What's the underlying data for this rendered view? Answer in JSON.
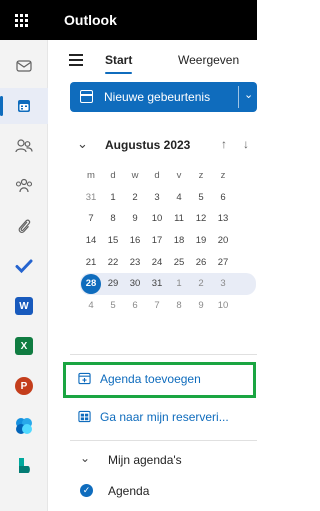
{
  "app": {
    "title": "Outlook"
  },
  "nav": {
    "tabs": [
      {
        "label": "Start"
      },
      {
        "label": "Weergeven"
      }
    ]
  },
  "toolbar": {
    "new_event_label": "Nieuwe gebeurtenis"
  },
  "rail": {
    "items": [
      {
        "icon": "mail-icon"
      },
      {
        "icon": "calendar-icon"
      },
      {
        "icon": "people-icon"
      },
      {
        "icon": "groups-icon"
      },
      {
        "icon": "attachment-icon"
      },
      {
        "icon": "todo-icon"
      },
      {
        "icon": "word-icon"
      },
      {
        "icon": "excel-icon"
      },
      {
        "icon": "powerpoint-icon"
      },
      {
        "icon": "copilot-icon"
      },
      {
        "icon": "bookings-icon"
      }
    ]
  },
  "calendar": {
    "month_label": "Augustus 2023",
    "weekday_headers": [
      "m",
      "d",
      "w",
      "d",
      "v",
      "z",
      "z"
    ],
    "weeks": [
      [
        "31",
        "1",
        "2",
        "3",
        "4",
        "5",
        "6"
      ],
      [
        "7",
        "8",
        "9",
        "10",
        "11",
        "12",
        "13"
      ],
      [
        "14",
        "15",
        "16",
        "17",
        "18",
        "19",
        "20"
      ],
      [
        "21",
        "22",
        "23",
        "24",
        "25",
        "26",
        "27"
      ],
      [
        "28",
        "29",
        "30",
        "31",
        "1",
        "2",
        "3"
      ],
      [
        "4",
        "5",
        "6",
        "7",
        "8",
        "9",
        "10"
      ]
    ],
    "today": "28"
  },
  "links": {
    "add_calendar": "Agenda toevoegen",
    "booking": "Ga naar mijn reserveri..."
  },
  "my_calendars": {
    "header": "Mijn agenda's",
    "items": [
      {
        "label": "Agenda"
      }
    ]
  },
  "colors": {
    "accent": "#0f6cbd",
    "highlight": "#1aa541",
    "topbar": "#000000"
  }
}
